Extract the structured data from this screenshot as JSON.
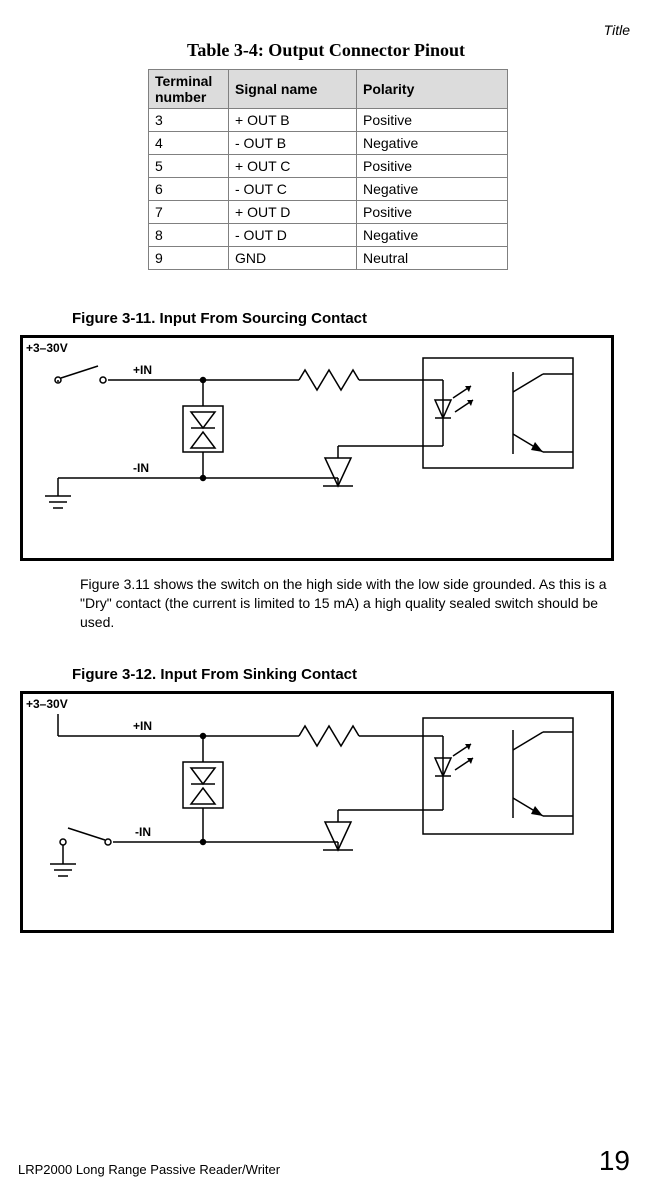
{
  "header": {
    "running_title": "Title"
  },
  "table": {
    "caption": "Table 3-4:  Output Connector Pinout",
    "headers": [
      "Terminal number",
      "Signal name",
      "Polarity"
    ],
    "rows": [
      {
        "num": "3",
        "signal": "+ OUT B",
        "polarity": "Positive"
      },
      {
        "num": "4",
        "signal": "- OUT B",
        "polarity": "Negative"
      },
      {
        "num": "5",
        "signal": "+ OUT C",
        "polarity": "Positive"
      },
      {
        "num": "6",
        "signal": "- OUT C",
        "polarity": "Negative"
      },
      {
        "num": "7",
        "signal": "+ OUT D",
        "polarity": "Positive"
      },
      {
        "num": "8",
        "signal": "- OUT D",
        "polarity": "Negative"
      },
      {
        "num": "9",
        "signal": "GND",
        "polarity": "Neutral"
      }
    ]
  },
  "figure1": {
    "caption": "Figure 3-11. Input From Sourcing Contact",
    "labels": {
      "supply": "+3–30V",
      "in_pos": "+IN",
      "in_neg": "-IN"
    }
  },
  "paragraph1": "Figure 3.11 shows the switch on the high side with the low side grounded. As this is a \"Dry\" contact (the current is limited to 15 mA) a high quality sealed switch should be used.",
  "figure2": {
    "caption": "Figure 3-12. Input From Sinking Contact",
    "labels": {
      "supply": "+3–30V",
      "in_pos": "+IN",
      "in_neg": "-IN"
    }
  },
  "footer": {
    "doc_title": "LRP2000 Long Range Passive Reader/Writer",
    "page_number": "19"
  },
  "chart_data": [
    {
      "type": "table",
      "title": "Table 3-4: Output Connector Pinout",
      "columns": [
        "Terminal number",
        "Signal name",
        "Polarity"
      ],
      "rows": [
        [
          "3",
          "+ OUT B",
          "Positive"
        ],
        [
          "4",
          "- OUT B",
          "Negative"
        ],
        [
          "5",
          "+ OUT C",
          "Positive"
        ],
        [
          "6",
          "- OUT C",
          "Negative"
        ],
        [
          "7",
          "+ OUT D",
          "Positive"
        ],
        [
          "8",
          "- OUT D",
          "Negative"
        ],
        [
          "9",
          "GND",
          "Neutral"
        ]
      ]
    }
  ]
}
